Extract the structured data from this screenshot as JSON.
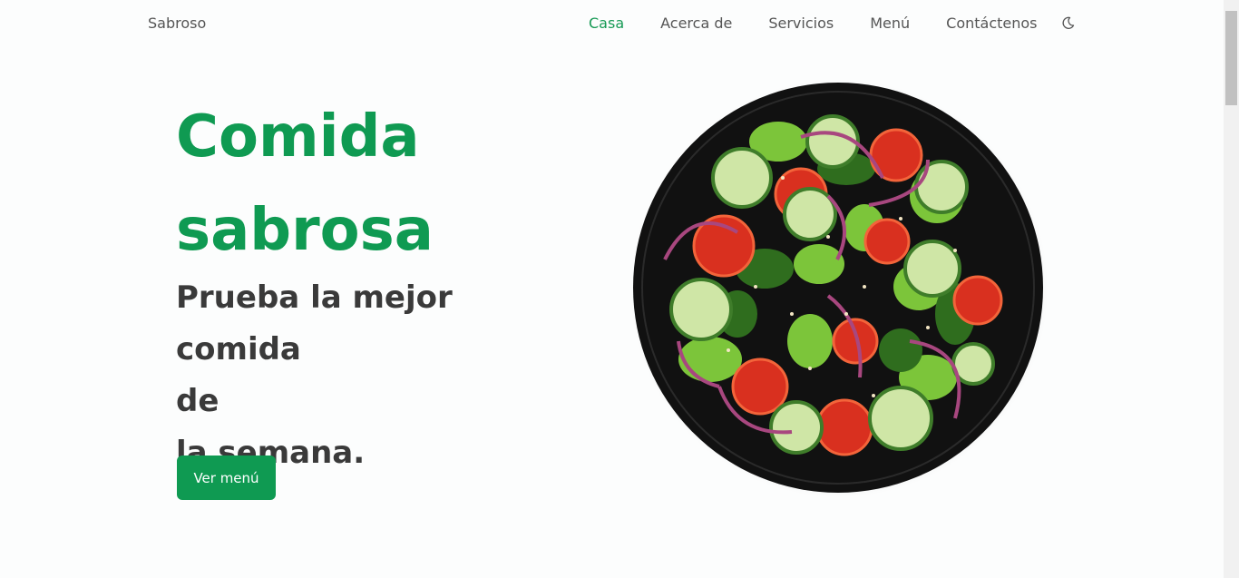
{
  "header": {
    "logo": "Sabroso",
    "nav": [
      {
        "label": "Casa",
        "active": true
      },
      {
        "label": "Acerca de",
        "active": false
      },
      {
        "label": "Servicios",
        "active": false
      },
      {
        "label": "Menú",
        "active": false
      },
      {
        "label": "Contáctenos",
        "active": false
      }
    ],
    "theme_toggle_icon": "moon-icon"
  },
  "hero": {
    "title_line1": "Comida",
    "title_line2": "sabrosa",
    "subtitle_line1": "Prueba la mejor comida",
    "subtitle_line2": "de",
    "subtitle_line3": "la semana.",
    "cta_label": "Ver menú",
    "image_icon": "salad-plate-image"
  },
  "colors": {
    "accent": "#0f9a52",
    "text_dark": "#3a3a3a",
    "background": "#fcfdfd"
  }
}
